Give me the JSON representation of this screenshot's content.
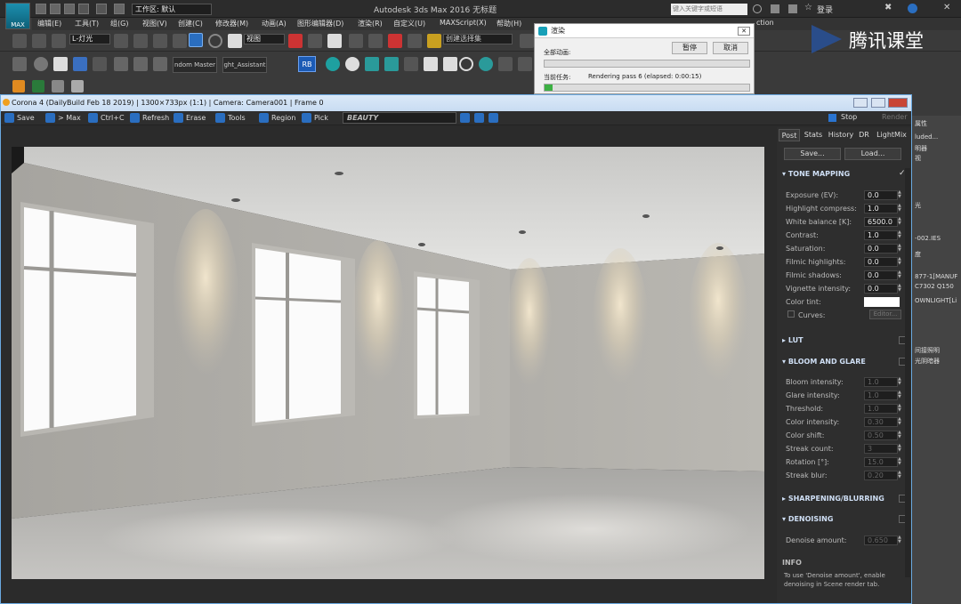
{
  "max": {
    "logo_label": "MAX",
    "workspace": "工作区: 默认",
    "title": "Autodesk 3ds Max 2016    无标题",
    "search_placeholder": "键入关键字或短语",
    "login": "登录",
    "menu": [
      "编辑(E)",
      "工具(T)",
      "组(G)",
      "视图(V)",
      "创建(C)",
      "修改器(M)",
      "动画(A)",
      "图形编辑器(D)",
      "渲染(R)",
      "自定义(U)",
      "MAXScript(X)",
      "帮助(H)"
    ],
    "menu_extra": "ction",
    "selection_filter": "L-灯光",
    "view_combo": "视图",
    "named_selection": "创建选择集",
    "ribbon_tabs": [
      "ndom Master",
      "ght_Assistant"
    ],
    "rb": "RB",
    "brand": "腾讯课堂"
  },
  "progress": {
    "title": "渲染",
    "pause": "暂停",
    "cancel": "取消",
    "all_animation": "全部动画:",
    "current_task": "当前任务:",
    "task_text": "Rendering pass 6 (elapsed: 0:00:15)",
    "all_progress": 0.0,
    "current_progress": 0.04
  },
  "right_panel": [
    "属性",
    "luded...",
    "明器",
    "视",
    "光",
    "-002.IES",
    "度",
    "877-1[MANUF",
    "C7302 Q150",
    "OWNLIGHT[Li",
    "间接照明",
    "光阴暗器"
  ],
  "vfb": {
    "title": "Corona 4 (DailyBuild Feb 18 2019) | 1300×733px (1:1) | Camera: Camera001 | Frame 0",
    "tools": [
      "Save",
      "> Max",
      "Ctrl+C",
      "Refresh",
      "Erase",
      "Tools",
      "Region",
      "Pick"
    ],
    "channel": "BEAUTY",
    "stop": "Stop",
    "render": "Render",
    "tabs": [
      "Post",
      "Stats",
      "History",
      "DR",
      "LightMix"
    ],
    "save_btn": "Save...",
    "load_btn": "Load...",
    "tone_mapping": {
      "header": "TONE MAPPING",
      "rows": [
        {
          "label": "Exposure (EV):",
          "value": "0.0"
        },
        {
          "label": "Highlight compress:",
          "value": "1.0"
        },
        {
          "label": "White balance [K]:",
          "value": "6500.0"
        },
        {
          "label": "Contrast:",
          "value": "1.0"
        },
        {
          "label": "Saturation:",
          "value": "0.0"
        },
        {
          "label": "Filmic highlights:",
          "value": "0.0"
        },
        {
          "label": "Filmic shadows:",
          "value": "0.0"
        },
        {
          "label": "Vignette intensity:",
          "value": "0.0"
        }
      ],
      "color_tint": "Color tint:",
      "curves": "Curves:",
      "editor": "Editor..."
    },
    "lut": "LUT",
    "bloom": {
      "header": "BLOOM AND GLARE",
      "rows": [
        {
          "label": "Bloom intensity:",
          "value": "1.0"
        },
        {
          "label": "Glare intensity:",
          "value": "1.0"
        },
        {
          "label": "Threshold:",
          "value": "1.0"
        },
        {
          "label": "Color intensity:",
          "value": "0.30"
        },
        {
          "label": "Color shift:",
          "value": "0.50"
        },
        {
          "label": "Streak count:",
          "value": "3"
        },
        {
          "label": "Rotation [°]:",
          "value": "15.0"
        },
        {
          "label": "Streak blur:",
          "value": "0.20"
        }
      ]
    },
    "sharpening": "SHARPENING/BLURRING",
    "denoising": {
      "header": "DENOISING",
      "label": "Denoise amount:",
      "value": "0.650"
    },
    "info": {
      "header": "INFO",
      "text": "To use 'Denoise amount', enable denoising in Scene render tab."
    }
  }
}
